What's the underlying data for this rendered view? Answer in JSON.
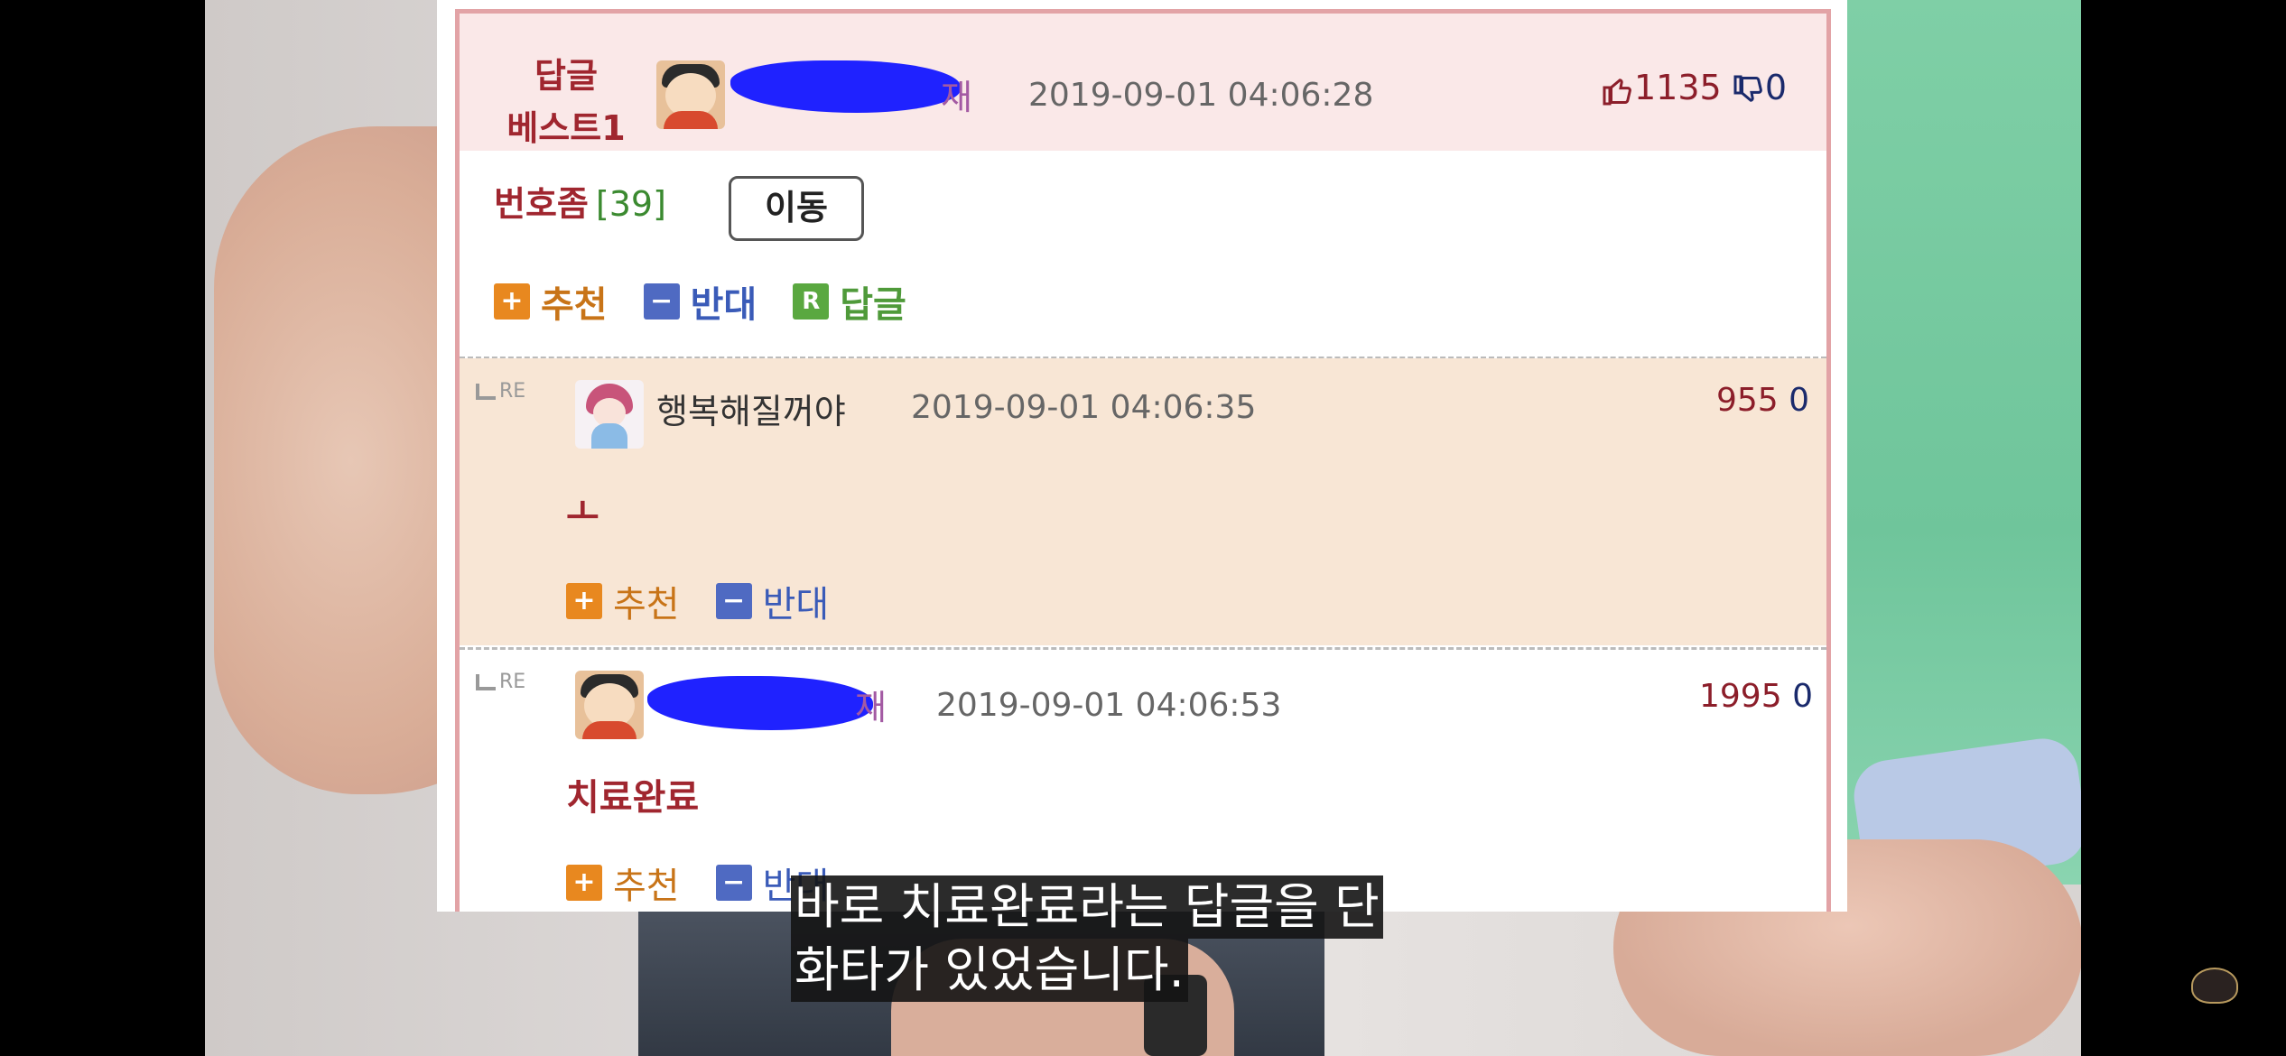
{
  "best": {
    "label_line1": "답글",
    "label_line2": "베스트1",
    "name_tail": "재",
    "timestamp": "2019-09-01 04:06:28",
    "up_votes": "1135",
    "down_votes": "0"
  },
  "nick_row": {
    "nick": "번호좀",
    "count": "[39]",
    "move_button": "이동"
  },
  "actions_main": {
    "up": "추천",
    "down": "반대",
    "reply": "답글",
    "plus_glyph": "+",
    "minus_glyph": "−",
    "reply_glyph": "R"
  },
  "replies": [
    {
      "re_label": "RE",
      "nick": "행복해질꺼야",
      "timestamp": "2019-09-01 04:06:35",
      "up": "955",
      "down": "0",
      "body": "ㅗ",
      "up_label": "추천",
      "down_label": "반대"
    },
    {
      "re_label": "RE",
      "name_tail": "재",
      "timestamp": "2019-09-01 04:06:53",
      "up": "1995",
      "down": "0",
      "body": "치료완료",
      "up_label": "추천",
      "down_label": "반대"
    }
  ],
  "caption": {
    "line1": "바로 치료완료라는 답글을 단",
    "line2": "화타가 있었습니다."
  },
  "colors": {
    "accent_red": "#a0262f",
    "up_orange": "#e8881f",
    "down_blue": "#4f6ac2",
    "reply_green": "#5aa840",
    "redaction_blue": "#1f22ff"
  }
}
